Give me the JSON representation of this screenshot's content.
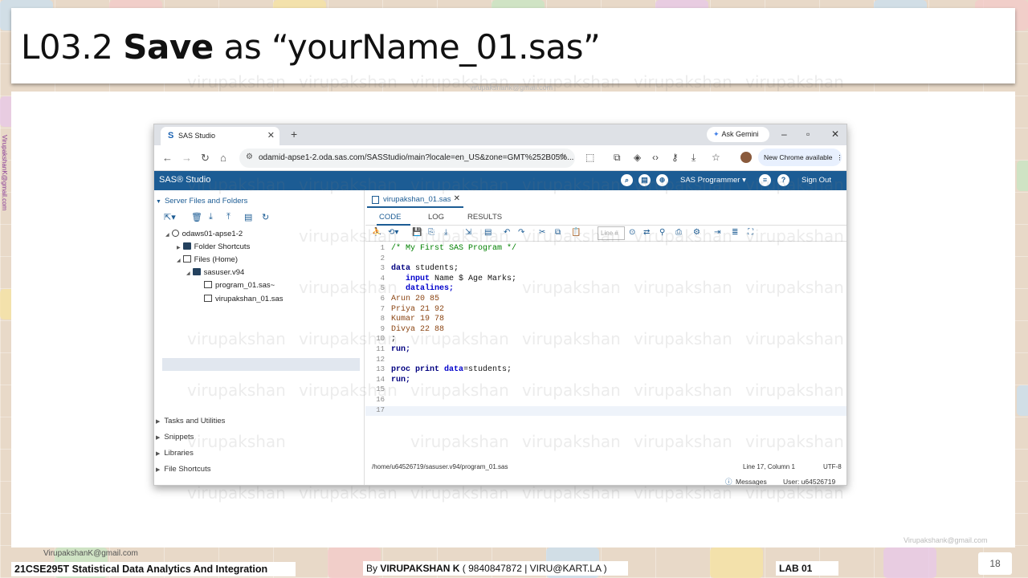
{
  "slide": {
    "title_prefix": "L03.2 ",
    "title_bold": "Save",
    "title_suffix": " as “yourName_01.sas”",
    "watermark": "virupakshan",
    "side_email": "VirupakshanK@gmail.com",
    "top_email": "virupakshank@gmail.com",
    "corner_email": "Virupakshank@gmail.com",
    "page_number": "18"
  },
  "browser": {
    "tab_label": "SAS Studio",
    "ask_gemini": "Ask Gemini",
    "url": "odamid-apse1-2.oda.sas.com/SASStudio/main?locale=en_US&zone=GMT%252B05%...",
    "new_chrome": "New Chrome available"
  },
  "sas": {
    "brand": "SAS® Studio",
    "role": "SAS Programmer",
    "sign_out": "Sign Out",
    "left_header": "Server Files and Folders",
    "tree": [
      {
        "label": "odaws01-apse1-2"
      },
      {
        "label": "Folder Shortcuts"
      },
      {
        "label": "Files (Home)"
      },
      {
        "label": "sasuser.v94"
      },
      {
        "label": "program_01.sas~"
      },
      {
        "label": "virupakshan_01.sas"
      }
    ],
    "sections": [
      "Tasks and Utilities",
      "Snippets",
      "Libraries",
      "File Shortcuts"
    ],
    "file_tab": "virupakshan_01.sas",
    "subtabs": [
      "CODE",
      "LOG",
      "RESULTS"
    ],
    "line_placeholder": "Line #",
    "status_path": "/home/u64526719/sasuser.v94/program_01.sas",
    "status_pos": "Line 17, Column 1",
    "status_enc": "UTF-8",
    "messages": "Messages",
    "user": "User: u64526719"
  },
  "code": {
    "l1": "/* My First SAS Program */",
    "l3_kw": "data",
    "l3_rest": " students;",
    "l4_kw": "input",
    "l4_rest": " Name $ Age Marks;",
    "l5_kw": "datalines;",
    "l6": "Arun 20 85",
    "l7": "Priya 21 92",
    "l8": "Kumar 19 78",
    "l9": "Divya 22 88",
    "l10": ";",
    "l11": "run;",
    "l13_kw1": "proc print",
    "l13_kw2": "data",
    "l13_rest": "=students;",
    "l14": "run;"
  },
  "footer": {
    "course": "21CSE295T Statistical Data Analytics And Integration",
    "by_prefix": "By ",
    "author": "VIRUPAKSHAN K",
    "contact": " ( 9840847872 | VIRU@KART.LA )",
    "lab": "LAB  01",
    "email": "VirupakshanK@gmail.com"
  }
}
